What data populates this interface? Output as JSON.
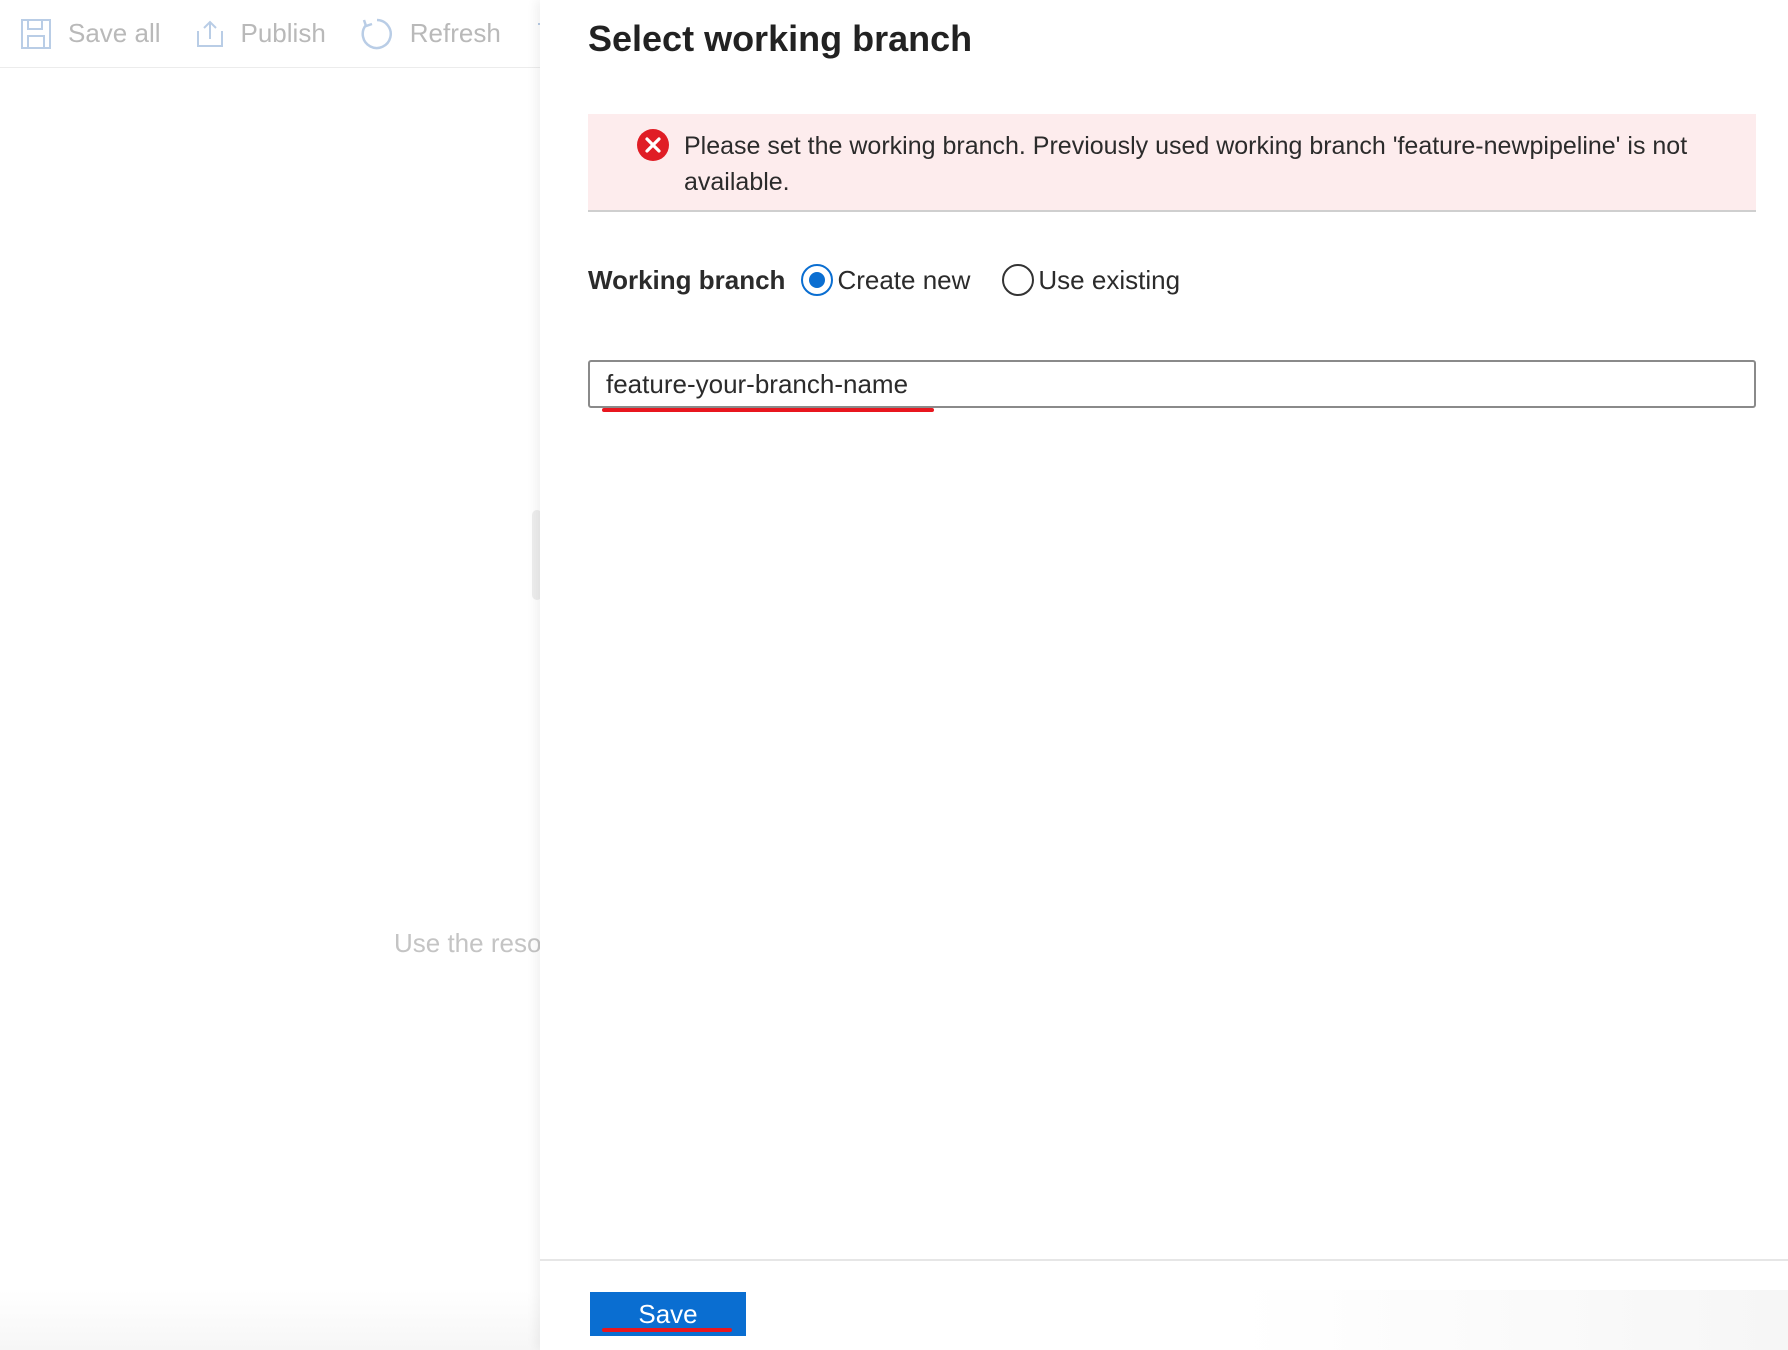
{
  "toolbar": {
    "save_all_label": "Save all",
    "publish_label": "Publish",
    "refresh_label": "Refresh"
  },
  "background": {
    "hint_text": "Use the reso"
  },
  "panel": {
    "title": "Select working branch",
    "error": {
      "icon": "error-circle-x-icon",
      "message": "Please set the working branch. Previously used working branch 'feature-newpipeline' is not available."
    },
    "working_branch": {
      "label": "Working branch",
      "options": [
        {
          "label": "Create new",
          "selected": true
        },
        {
          "label": "Use existing",
          "selected": false
        }
      ]
    },
    "branch_name_value": "feature-your-branch-name",
    "save_label": "Save"
  },
  "colors": {
    "accent": "#0a6ed1",
    "error_bg": "#fdeced",
    "error_icon": "#e01d25",
    "annotation_underline": "#e8171f"
  }
}
